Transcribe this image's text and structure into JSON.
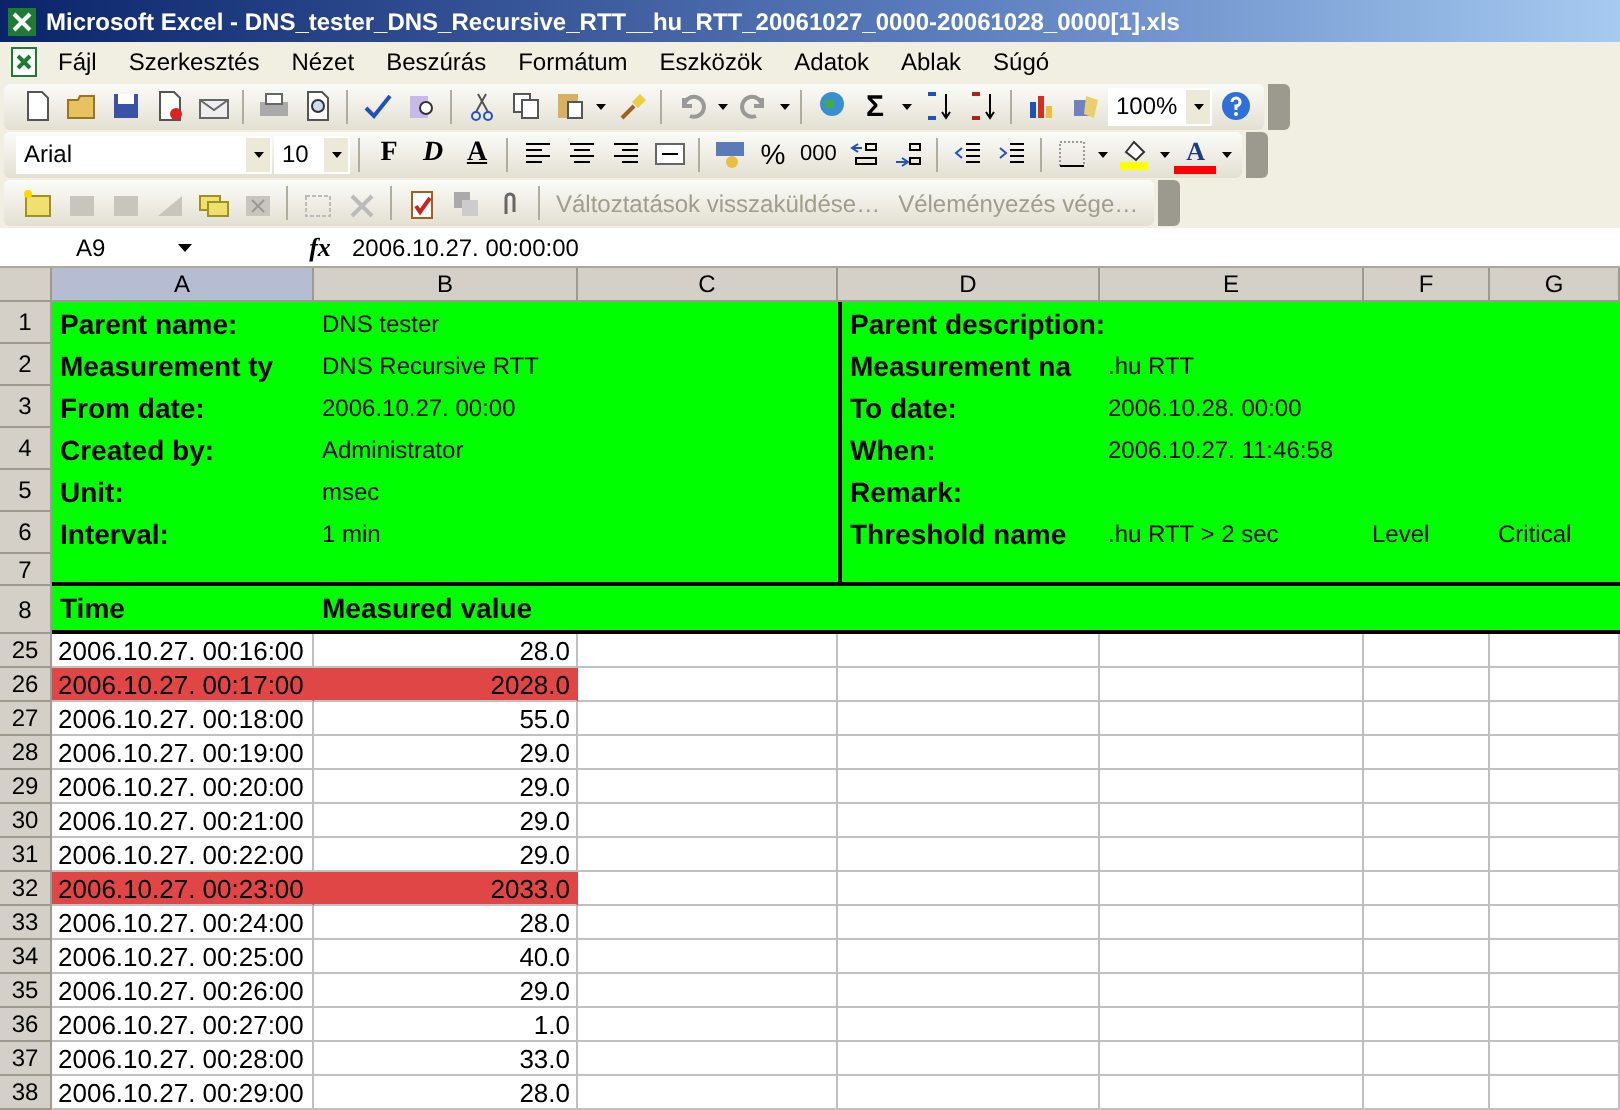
{
  "window": {
    "title": "Microsoft Excel - DNS_tester_DNS_Recursive_RTT__hu_RTT_20061027_0000-20061028_0000[1].xls"
  },
  "menu": [
    "Fájl",
    "Szerkesztés",
    "Nézet",
    "Beszúrás",
    "Formátum",
    "Eszközök",
    "Adatok",
    "Ablak",
    "Súgó"
  ],
  "toolbar_standard": {
    "sum": "Σ",
    "zoom": "100%"
  },
  "toolbar_formatting": {
    "font": "Arial",
    "size": "10",
    "bold": "F",
    "italic": "D",
    "underline": "A",
    "percent": "%",
    "thousands": "000",
    "font_color": "A"
  },
  "toolbar_reviewing": {
    "items": [
      {
        "label": "Változtatások visszaküldése…",
        "disabled": true
      },
      {
        "label": "Véleményezés vége…",
        "disabled": true
      }
    ]
  },
  "formula_bar": {
    "name_box": "A9",
    "fx": "fx",
    "value": "2006.10.27. 00:00:00"
  },
  "sheet": {
    "columns": [
      {
        "label": "A",
        "selected": true
      },
      {
        "label": "B",
        "selected": false
      },
      {
        "label": "C",
        "selected": false
      },
      {
        "label": "D",
        "selected": false
      },
      {
        "label": "E",
        "selected": false
      },
      {
        "label": "F",
        "selected": false
      },
      {
        "label": "G",
        "selected": false
      }
    ],
    "info_rows": [
      {
        "row": "1",
        "label_left": "Parent name:",
        "value_left": "DNS tester",
        "label_right": "Parent description:"
      },
      {
        "row": "2",
        "label_left": "Measurement ty",
        "value_left": "DNS Recursive RTT",
        "label_right": "Measurement na",
        "value_right": ".hu RTT"
      },
      {
        "row": "3",
        "label_left": "From date:",
        "value_left": "2006.10.27. 00:00",
        "label_right": "To date:",
        "value_right": "2006.10.28. 00:00"
      },
      {
        "row": "4",
        "label_left": "Created by:",
        "value_left": "Administrator",
        "label_right": "When:",
        "value_right": "2006.10.27. 11:46:58"
      },
      {
        "row": "5",
        "label_left": "Unit:",
        "value_left": "msec",
        "label_right": "Remark:"
      },
      {
        "row": "6",
        "label_left": "Interval:",
        "value_left": "1 min",
        "label_right": "Threshold name",
        "value_right": ".hu RTT > 2 sec",
        "col_f": "Level",
        "col_g": "Critical"
      },
      {
        "row": "7"
      }
    ],
    "table_header": {
      "row": "8",
      "time": "Time",
      "value": "Measured value"
    },
    "rows": [
      {
        "row": "25",
        "time": "2006.10.27. 00:16:00",
        "value": "28.0",
        "alert": false
      },
      {
        "row": "26",
        "time": "2006.10.27. 00:17:00",
        "value": "2028.0",
        "alert": true
      },
      {
        "row": "27",
        "time": "2006.10.27. 00:18:00",
        "value": "55.0",
        "alert": false
      },
      {
        "row": "28",
        "time": "2006.10.27. 00:19:00",
        "value": "29.0",
        "alert": false
      },
      {
        "row": "29",
        "time": "2006.10.27. 00:20:00",
        "value": "29.0",
        "alert": false
      },
      {
        "row": "30",
        "time": "2006.10.27. 00:21:00",
        "value": "29.0",
        "alert": false
      },
      {
        "row": "31",
        "time": "2006.10.27. 00:22:00",
        "value": "29.0",
        "alert": false
      },
      {
        "row": "32",
        "time": "2006.10.27. 00:23:00",
        "value": "2033.0",
        "alert": true
      },
      {
        "row": "33",
        "time": "2006.10.27. 00:24:00",
        "value": "28.0",
        "alert": false
      },
      {
        "row": "34",
        "time": "2006.10.27. 00:25:00",
        "value": "40.0",
        "alert": false
      },
      {
        "row": "35",
        "time": "2006.10.27. 00:26:00",
        "value": "29.0",
        "alert": false
      },
      {
        "row": "36",
        "time": "2006.10.27. 00:27:00",
        "value": "1.0",
        "alert": false
      },
      {
        "row": "37",
        "time": "2006.10.27. 00:28:00",
        "value": "33.0",
        "alert": false
      },
      {
        "row": "38",
        "time": "2006.10.27. 00:29:00",
        "value": "28.0",
        "alert": false
      }
    ]
  }
}
